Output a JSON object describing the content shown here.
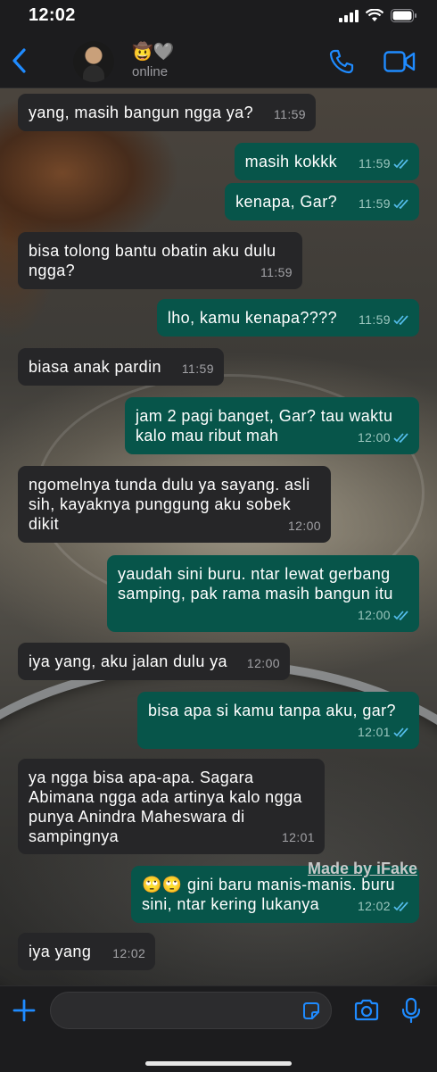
{
  "status_bar": {
    "time": "12:02"
  },
  "header": {
    "contact_name": "🤠🩶",
    "contact_status": "online",
    "accent_color": "#1f8bff"
  },
  "messages": [
    {
      "direction": "in",
      "text": "yang, masih bangun ngga ya?",
      "time": "11:59"
    },
    {
      "direction": "out",
      "text": "masih kokkk",
      "time": "11:59",
      "read": true
    },
    {
      "direction": "out",
      "text": "kenapa, Gar?",
      "time": "11:59",
      "read": true
    },
    {
      "direction": "in",
      "text": "bisa tolong bantu obatin aku dulu\nngga?",
      "time": "11:59"
    },
    {
      "direction": "out",
      "text": "lho, kamu kenapa????",
      "time": "11:59",
      "read": true
    },
    {
      "direction": "in",
      "text": "biasa anak pardin",
      "time": "11:59"
    },
    {
      "direction": "out",
      "text": "jam 2 pagi banget, Gar? tau waktu\nkalo mau ribut mah",
      "time": "12:00",
      "read": true
    },
    {
      "direction": "in",
      "text": "ngomelnya tunda dulu ya sayang. asli\nsih, kayaknya punggung aku sobek\ndikit",
      "time": "12:00"
    },
    {
      "direction": "out",
      "text": "yaudah sini buru. ntar lewat gerbang\nsamping, pak rama masih bangun itu",
      "time": "12:00",
      "read": true
    },
    {
      "direction": "in",
      "text": "iya yang, aku jalan dulu ya",
      "time": "12:00"
    },
    {
      "direction": "out",
      "text": "bisa apa si kamu tanpa aku, gar?",
      "time": "12:01",
      "read": true
    },
    {
      "direction": "in",
      "text": "ya ngga bisa apa-apa. Sagara\nAbimana ngga ada artinya kalo ngga\npunya Anindra Maheswara di\nsampingnya",
      "time": "12:01"
    },
    {
      "direction": "out",
      "text": "🙄🙄 gini baru manis-manis. buru\nsini, ntar kering lukanya",
      "time": "12:02",
      "read": true
    },
    {
      "direction": "in",
      "text": "iya yang",
      "time": "12:02"
    }
  ],
  "watermark": "Made by iFake",
  "input": {
    "value": "",
    "placeholder": ""
  },
  "icons": {
    "back": "chevron-left-icon",
    "call": "phone-icon",
    "video": "video-camera-icon",
    "plus": "plus-icon",
    "sticker": "sticker-icon",
    "camera": "camera-icon",
    "mic": "microphone-icon",
    "read": "double-check-icon"
  },
  "colors": {
    "incoming_bubble": "#262628",
    "outgoing_bubble": "#07554a",
    "read_tick": "#53bdeb",
    "bar_background": "#1c1c1e"
  }
}
